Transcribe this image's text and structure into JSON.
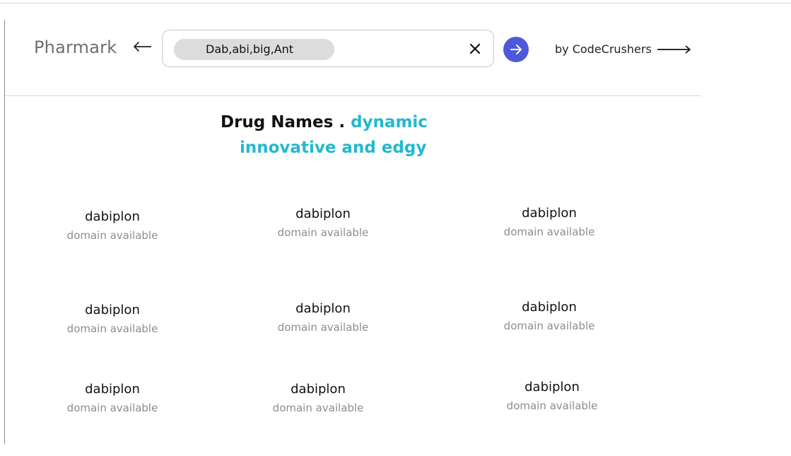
{
  "app": {
    "brand": "Pharmark",
    "byline": "by CodeCrushers"
  },
  "search": {
    "chip_text": "Dab,abi,big,Ant"
  },
  "icons": {
    "back": "left-arrow-icon",
    "clear": "close-icon",
    "submit": "right-arrow-icon",
    "byline_arrow": "long-right-arrow-icon"
  },
  "colors": {
    "accent": "#22b8cf",
    "button": "#4d59d8",
    "chip": "#dcdcdc",
    "muted_text": "#8d8d8d"
  },
  "results": {
    "heading": {
      "title": "Drug Names",
      "separator": ".",
      "tagline_part1": "dynamic",
      "tagline_part2": "innovative and edgy"
    },
    "items": [
      {
        "name": "dabiplon",
        "status": "domain available"
      },
      {
        "name": "dabiplon",
        "status": "domain available"
      },
      {
        "name": "dabiplon",
        "status": "domain available"
      },
      {
        "name": "dabiplon",
        "status": "domain available"
      },
      {
        "name": "dabiplon",
        "status": "domain available"
      },
      {
        "name": "dabiplon",
        "status": "domain available"
      },
      {
        "name": "dabiplon",
        "status": "domain available"
      },
      {
        "name": "dabiplon",
        "status": "domain available"
      },
      {
        "name": "dabiplon",
        "status": "domain available"
      }
    ]
  }
}
